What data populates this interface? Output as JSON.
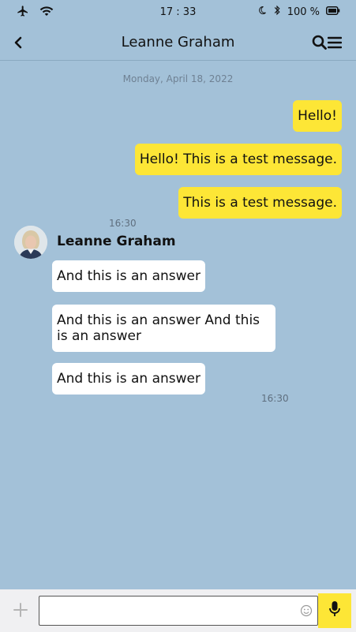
{
  "status_bar": {
    "time": "17 : 33",
    "battery": "100 %",
    "icons": [
      "airplane-icon",
      "wifi-icon",
      "moon-icon",
      "bluetooth-icon",
      "battery-icon"
    ]
  },
  "header": {
    "title": "Leanne Graham",
    "icons": [
      "back-icon",
      "search-icon",
      "menu-icon"
    ]
  },
  "chat": {
    "date": "Monday, April 18, 2022",
    "outgoing": [
      {
        "text": "Hello!"
      },
      {
        "text": "Hello! This is a test message."
      },
      {
        "text": "This is a test message."
      }
    ],
    "outgoing_time": "16:30",
    "sender_name": "Leanne Graham",
    "incoming": [
      {
        "text": "And this is an answer"
      },
      {
        "text": "And this is an answer And this is an answer"
      },
      {
        "text": "And this is an answer"
      }
    ],
    "incoming_time": "16:30"
  },
  "composer": {
    "placeholder": "",
    "value": "",
    "icons": [
      "plus-icon",
      "emoji-icon",
      "microphone-icon"
    ]
  },
  "colors": {
    "background": "#a3c1d8",
    "outgoing_bubble": "#fde636",
    "incoming_bubble": "#ffffff",
    "mic_button": "#fde636"
  }
}
